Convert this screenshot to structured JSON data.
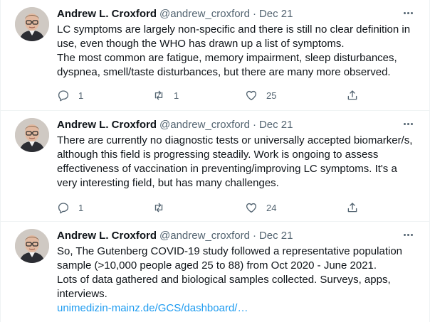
{
  "author": {
    "name": "Andrew L. Croxford",
    "handle": "@andrew_croxford",
    "separator": "·"
  },
  "tweets": [
    {
      "date": "Dec 21",
      "lines": [
        "LC symptoms are largely non-specific and there is still no clear definition in",
        "use, even though the WHO has drawn up a list of symptoms.",
        "The most common are fatigue, memory impairment, sleep disturbances,",
        "dyspnea, smell/taste disturbances, but there are many more observed."
      ],
      "replies": "1",
      "retweets": "1",
      "likes": "25"
    },
    {
      "date": "Dec 21",
      "lines": [
        "There are currently no diagnostic tests or universally accepted biomarker/s,",
        "although this field is progressing steadily. Work is ongoing to assess",
        "effectiveness of vaccination in preventing/improving LC symptoms. It's a",
        "very interesting field, but has many challenges."
      ],
      "replies": "1",
      "retweets": "",
      "likes": "24"
    },
    {
      "date": "Dec 21",
      "lines": [
        "So, The Gutenberg COVID-19 study followed a representative population",
        "sample (>10,000 people aged 25 to 88) from Oct 2020 - June 2021.",
        "Lots of data gathered and biological samples collected. Surveys, apps,",
        "interviews."
      ],
      "link": "unimedizin-mainz.de/GCS/dashboard/…"
    }
  ],
  "colors": {
    "text": "#0f1419",
    "secondary": "#536471",
    "link": "#1d9bf0",
    "divider": "#eff3f4"
  },
  "icons": [
    "reply-icon",
    "retweet-icon",
    "like-icon",
    "share-icon",
    "more-icon"
  ]
}
